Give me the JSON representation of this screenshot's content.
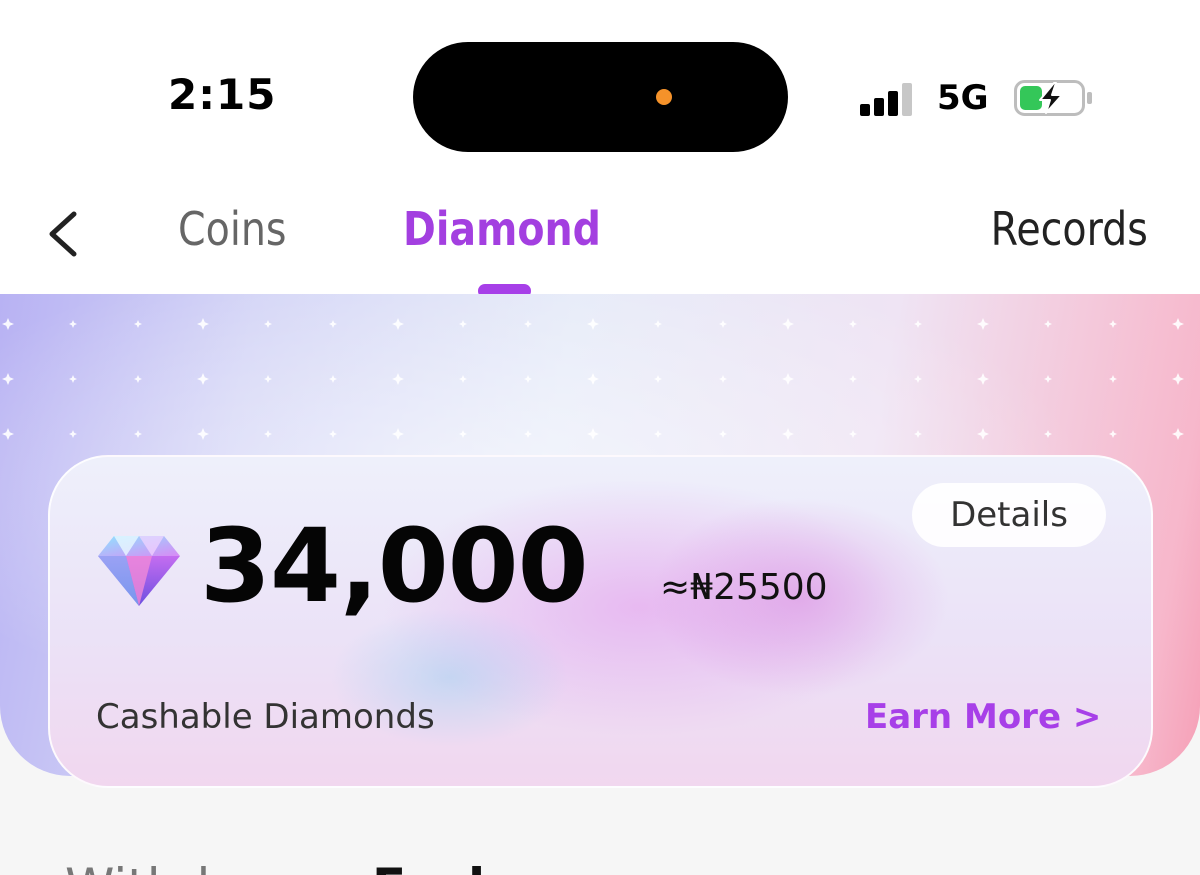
{
  "status_bar": {
    "time": "2:15",
    "network": "5G",
    "icons": [
      "signal-icon",
      "battery-charging-icon"
    ],
    "island_dot_color": "#f5922a",
    "battery_color": "#34c759"
  },
  "nav": {
    "back_icon": "chevron-left-icon",
    "tabs": [
      {
        "label": "Coins",
        "active": false
      },
      {
        "label": "Diamond",
        "active": true
      }
    ],
    "records_label": "Records",
    "accent_color": "#a73fe8"
  },
  "balance_card": {
    "details_label": "Details",
    "gem_icon": "diamond-gem-icon",
    "amount": "34,000",
    "approx_value": "≈₦25500",
    "label": "Cashable Diamonds",
    "earn_more_label": "Earn More >"
  },
  "bottom": {
    "left_partial": "Withdraw",
    "right_partial": "Exch"
  }
}
